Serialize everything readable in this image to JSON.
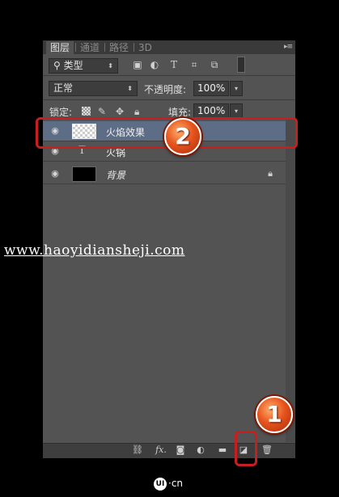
{
  "tabs": [
    "图层",
    "通道",
    "路径",
    "3D"
  ],
  "filter": {
    "label": "类型",
    "icon_names": [
      "image-filter-icon",
      "adjustment-filter-icon",
      "type-filter-icon",
      "shape-filter-icon",
      "smart-object-filter-icon",
      "filter-toggle-icon"
    ]
  },
  "blend": {
    "mode": "正常",
    "opacity_label": "不透明度:",
    "opacity_value": "100%"
  },
  "lock": {
    "label": "锁定:",
    "fill_label": "填充:",
    "fill_value": "100%"
  },
  "layers": [
    {
      "name": "火焰效果",
      "type": "raster-transparent",
      "selected": true
    },
    {
      "name": "火锅",
      "type": "text",
      "selected": false
    },
    {
      "name": "背景",
      "type": "background",
      "locked": true,
      "selected": false
    }
  ],
  "text_layer_glyph": "T",
  "bottom_icons": [
    "link-icon",
    "fx-icon",
    "mask-icon",
    "adjustment-icon",
    "folder-icon",
    "new-layer-icon",
    "delete-icon"
  ],
  "fx_label": "fx.",
  "watermark": "www.haoyidiansheji.com",
  "badges": {
    "one": "1",
    "two": "2"
  },
  "logo": {
    "mark": "UI",
    "suffix": "·cn"
  },
  "colors": {
    "panel": "#535353",
    "selected_layer": "#5e6d86",
    "callout": "#c71f1f",
    "badge": "#e8551d"
  }
}
